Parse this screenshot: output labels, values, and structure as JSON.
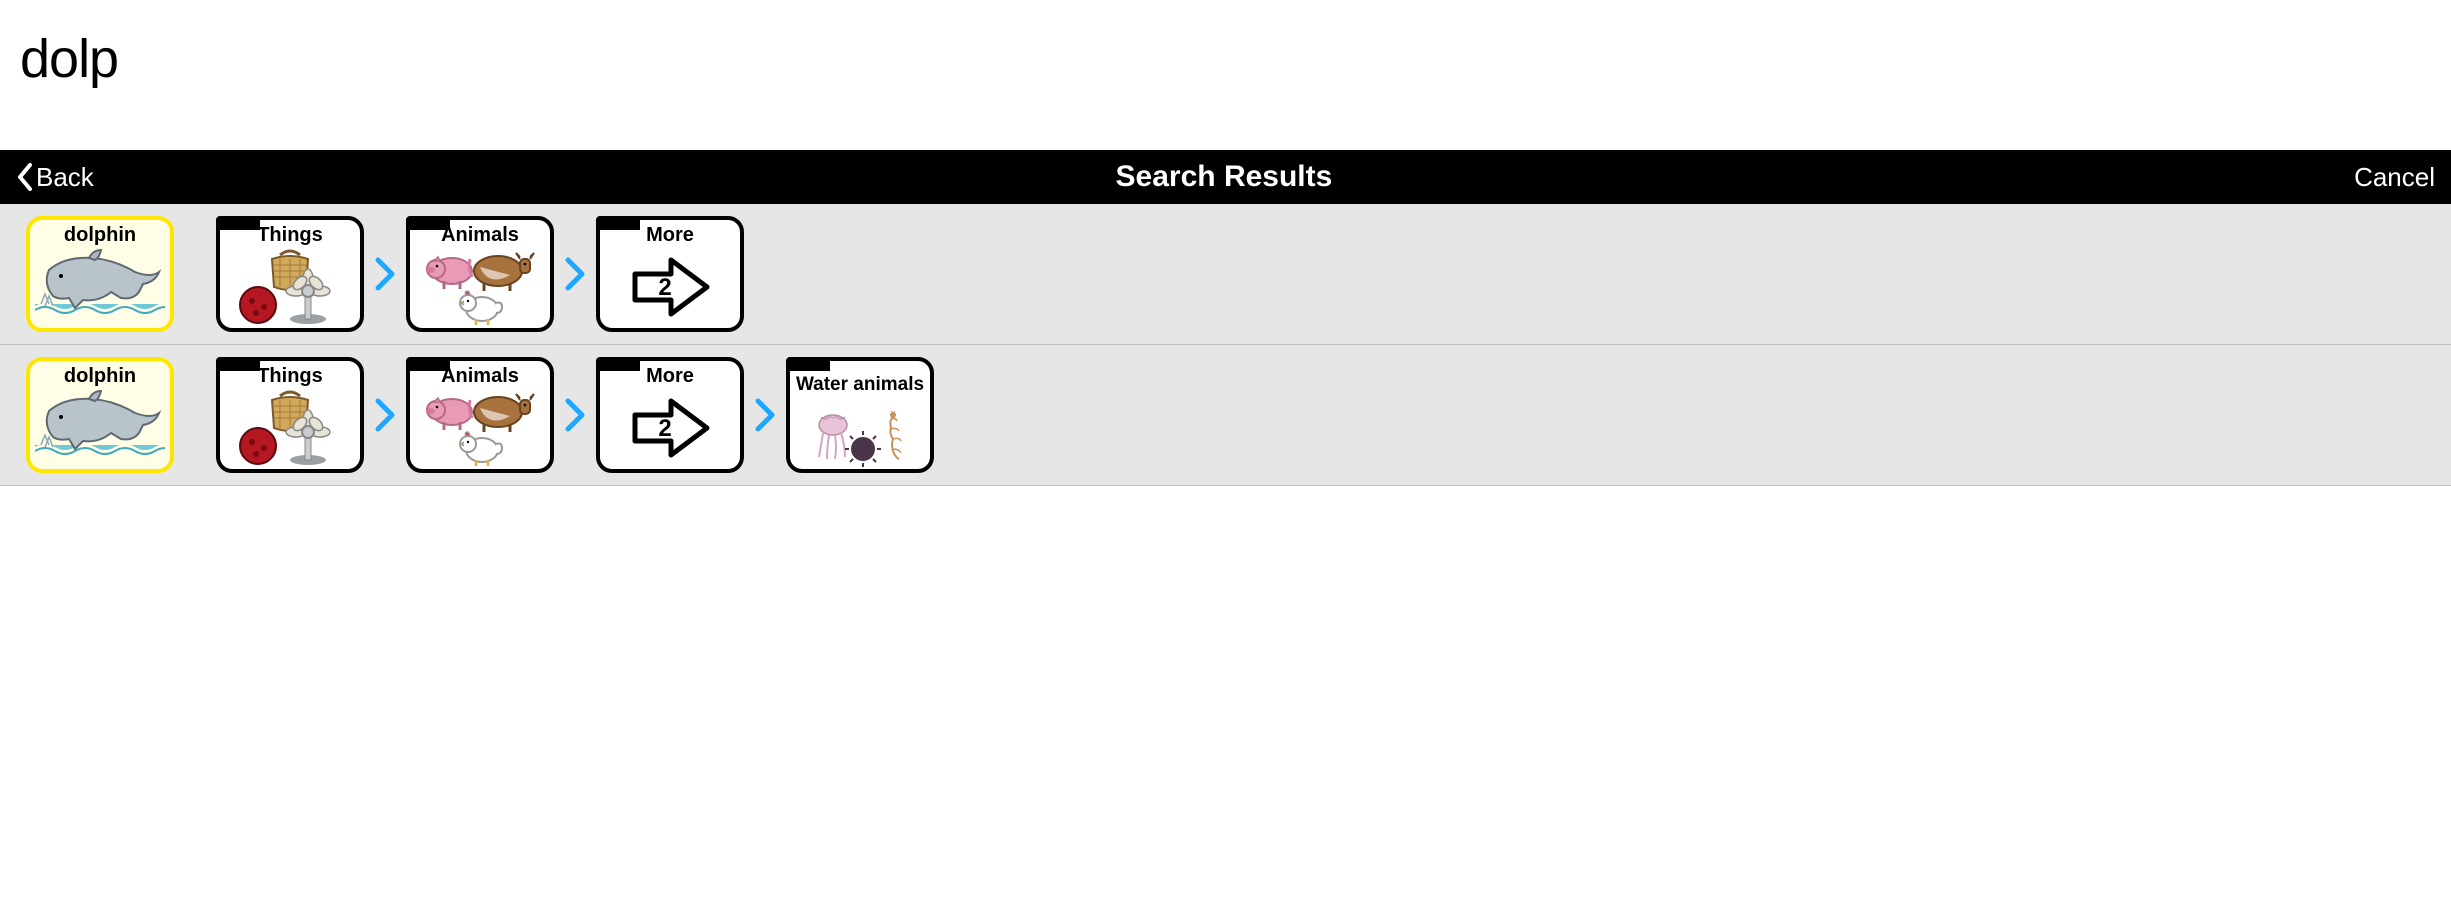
{
  "search": {
    "query": "dolp"
  },
  "header": {
    "back": "Back",
    "title": "Search Results",
    "cancel": "Cancel"
  },
  "results": [
    {
      "target": {
        "label": "dolphin",
        "icon": "dolphin",
        "highlight": true
      },
      "path": [
        {
          "label": "Things",
          "icon": "things",
          "folder": true
        },
        {
          "label": "Animals",
          "icon": "animals",
          "folder": true
        },
        {
          "label": "More",
          "icon": "more-2",
          "folder": true
        }
      ]
    },
    {
      "target": {
        "label": "dolphin",
        "icon": "dolphin",
        "highlight": true
      },
      "path": [
        {
          "label": "Things",
          "icon": "things",
          "folder": true
        },
        {
          "label": "Animals",
          "icon": "animals",
          "folder": true
        },
        {
          "label": "More",
          "icon": "more-2",
          "folder": true
        },
        {
          "label": "Water animals",
          "icon": "water-animals",
          "folder": true,
          "twoline": true
        }
      ]
    }
  ],
  "icons": {
    "more_number": "2"
  }
}
